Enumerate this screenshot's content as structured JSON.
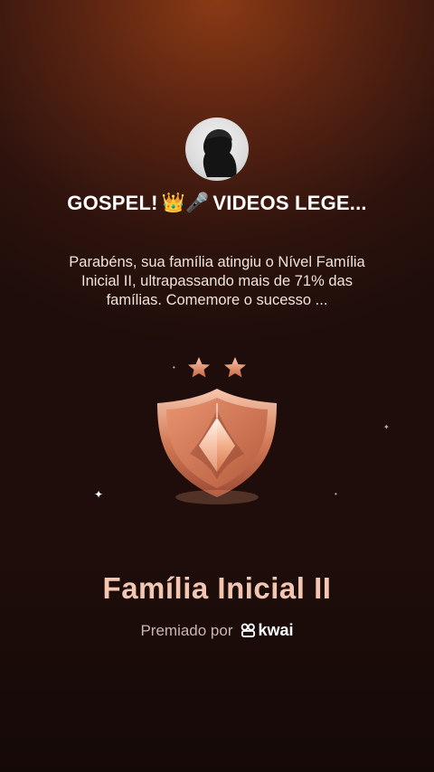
{
  "header": {
    "group_name": "GOSPEL!",
    "group_name_emoji": "👑🎤",
    "group_name_rest": "VIDEOS LEGE..."
  },
  "avatar": {
    "icon": "user-silhouette-icon"
  },
  "message": {
    "text": "Parabéns, sua família atingiu o Nível Família Inicial II, ultrapassando mais de 71% das famílias. Comemore o sucesso ..."
  },
  "badge": {
    "stars": 2,
    "icon": "shield-badge-icon",
    "colors": {
      "shield": "#e08c6a",
      "star": "#e3a07a",
      "accent": "#f6d3bf"
    }
  },
  "level": {
    "title": "Família Inicial II"
  },
  "footer": {
    "awarded_by": "Premiado por",
    "brand": "kwai"
  }
}
